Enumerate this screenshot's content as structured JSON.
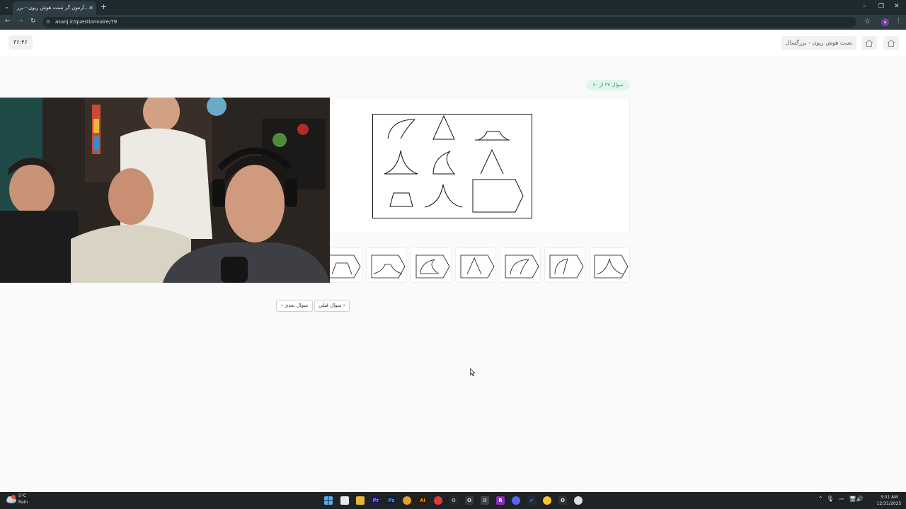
{
  "browser": {
    "tab_title": "آزمون گر تست هوش ریون - بزر...",
    "tab_close": "✕",
    "new_tab": "+",
    "url": "asanj.ir/questionnaire/79",
    "profile_initial": "a"
  },
  "header": {
    "timer": "۳۶:۴۶",
    "test_title": "تست هوش ریون - بزرگسال"
  },
  "question": {
    "badge": "سوال ۳۷ از ۶۰"
  },
  "navigation": {
    "next_label": "سوال بعدی",
    "prev_label": "سوال قبلی"
  },
  "taskbar": {
    "weather_temp": "5°C",
    "weather_cond": "Rain",
    "clock_time": "3:01 AM",
    "clock_date": "12/31/2025"
  },
  "colors": {
    "badge_bg": "#e1f5ea",
    "badge_text": "#2f9a62",
    "chrome_dark": "#1d2a30"
  }
}
